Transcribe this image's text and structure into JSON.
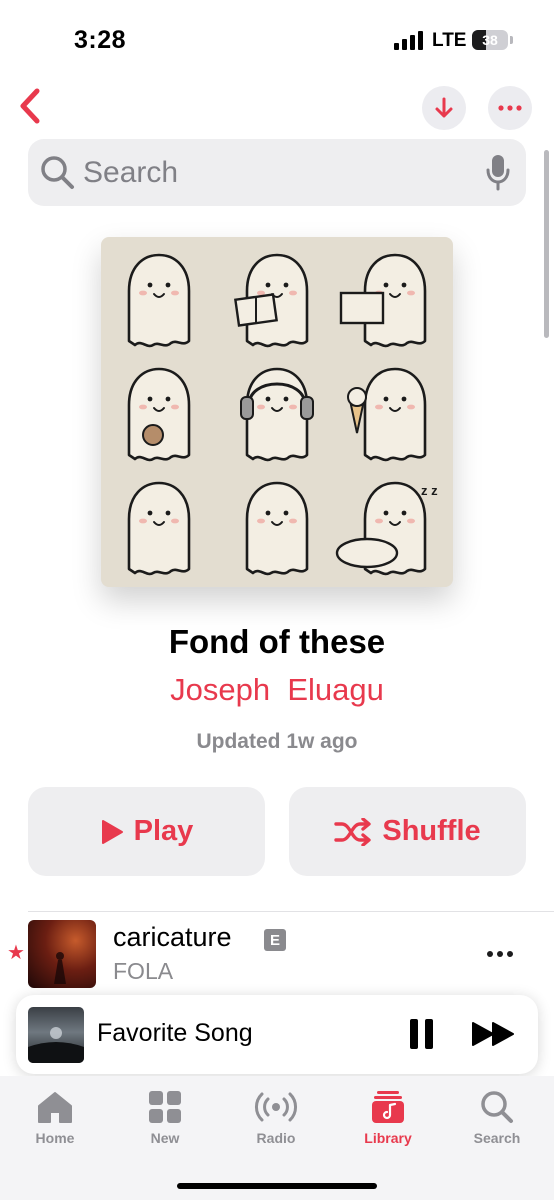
{
  "status_bar": {
    "time": "3:28",
    "network": "LTE",
    "battery": "38",
    "battery_level": 0.38
  },
  "search": {
    "placeholder": "Search"
  },
  "playlist": {
    "title": "Fond of these",
    "owner": "Joseph  Eluagu",
    "updated": "Updated 1w ago"
  },
  "actions": {
    "play": "Play",
    "shuffle": "Shuffle"
  },
  "songs": [
    {
      "title": "caricature",
      "artist": "FOLA",
      "explicit": "E",
      "favorite": "★"
    }
  ],
  "now_playing": {
    "title": "Favorite Song"
  },
  "tabs": [
    {
      "label": "Home",
      "icon": "home-icon"
    },
    {
      "label": "New",
      "icon": "grid-icon"
    },
    {
      "label": "Radio",
      "icon": "radio-icon"
    },
    {
      "label": "Library",
      "icon": "library-icon",
      "active": true
    },
    {
      "label": "Search",
      "icon": "search-icon"
    }
  ],
  "colors": {
    "accent": "#e8394d",
    "secondary_text": "#8a8a8e",
    "control_bg": "#eeeef0"
  }
}
